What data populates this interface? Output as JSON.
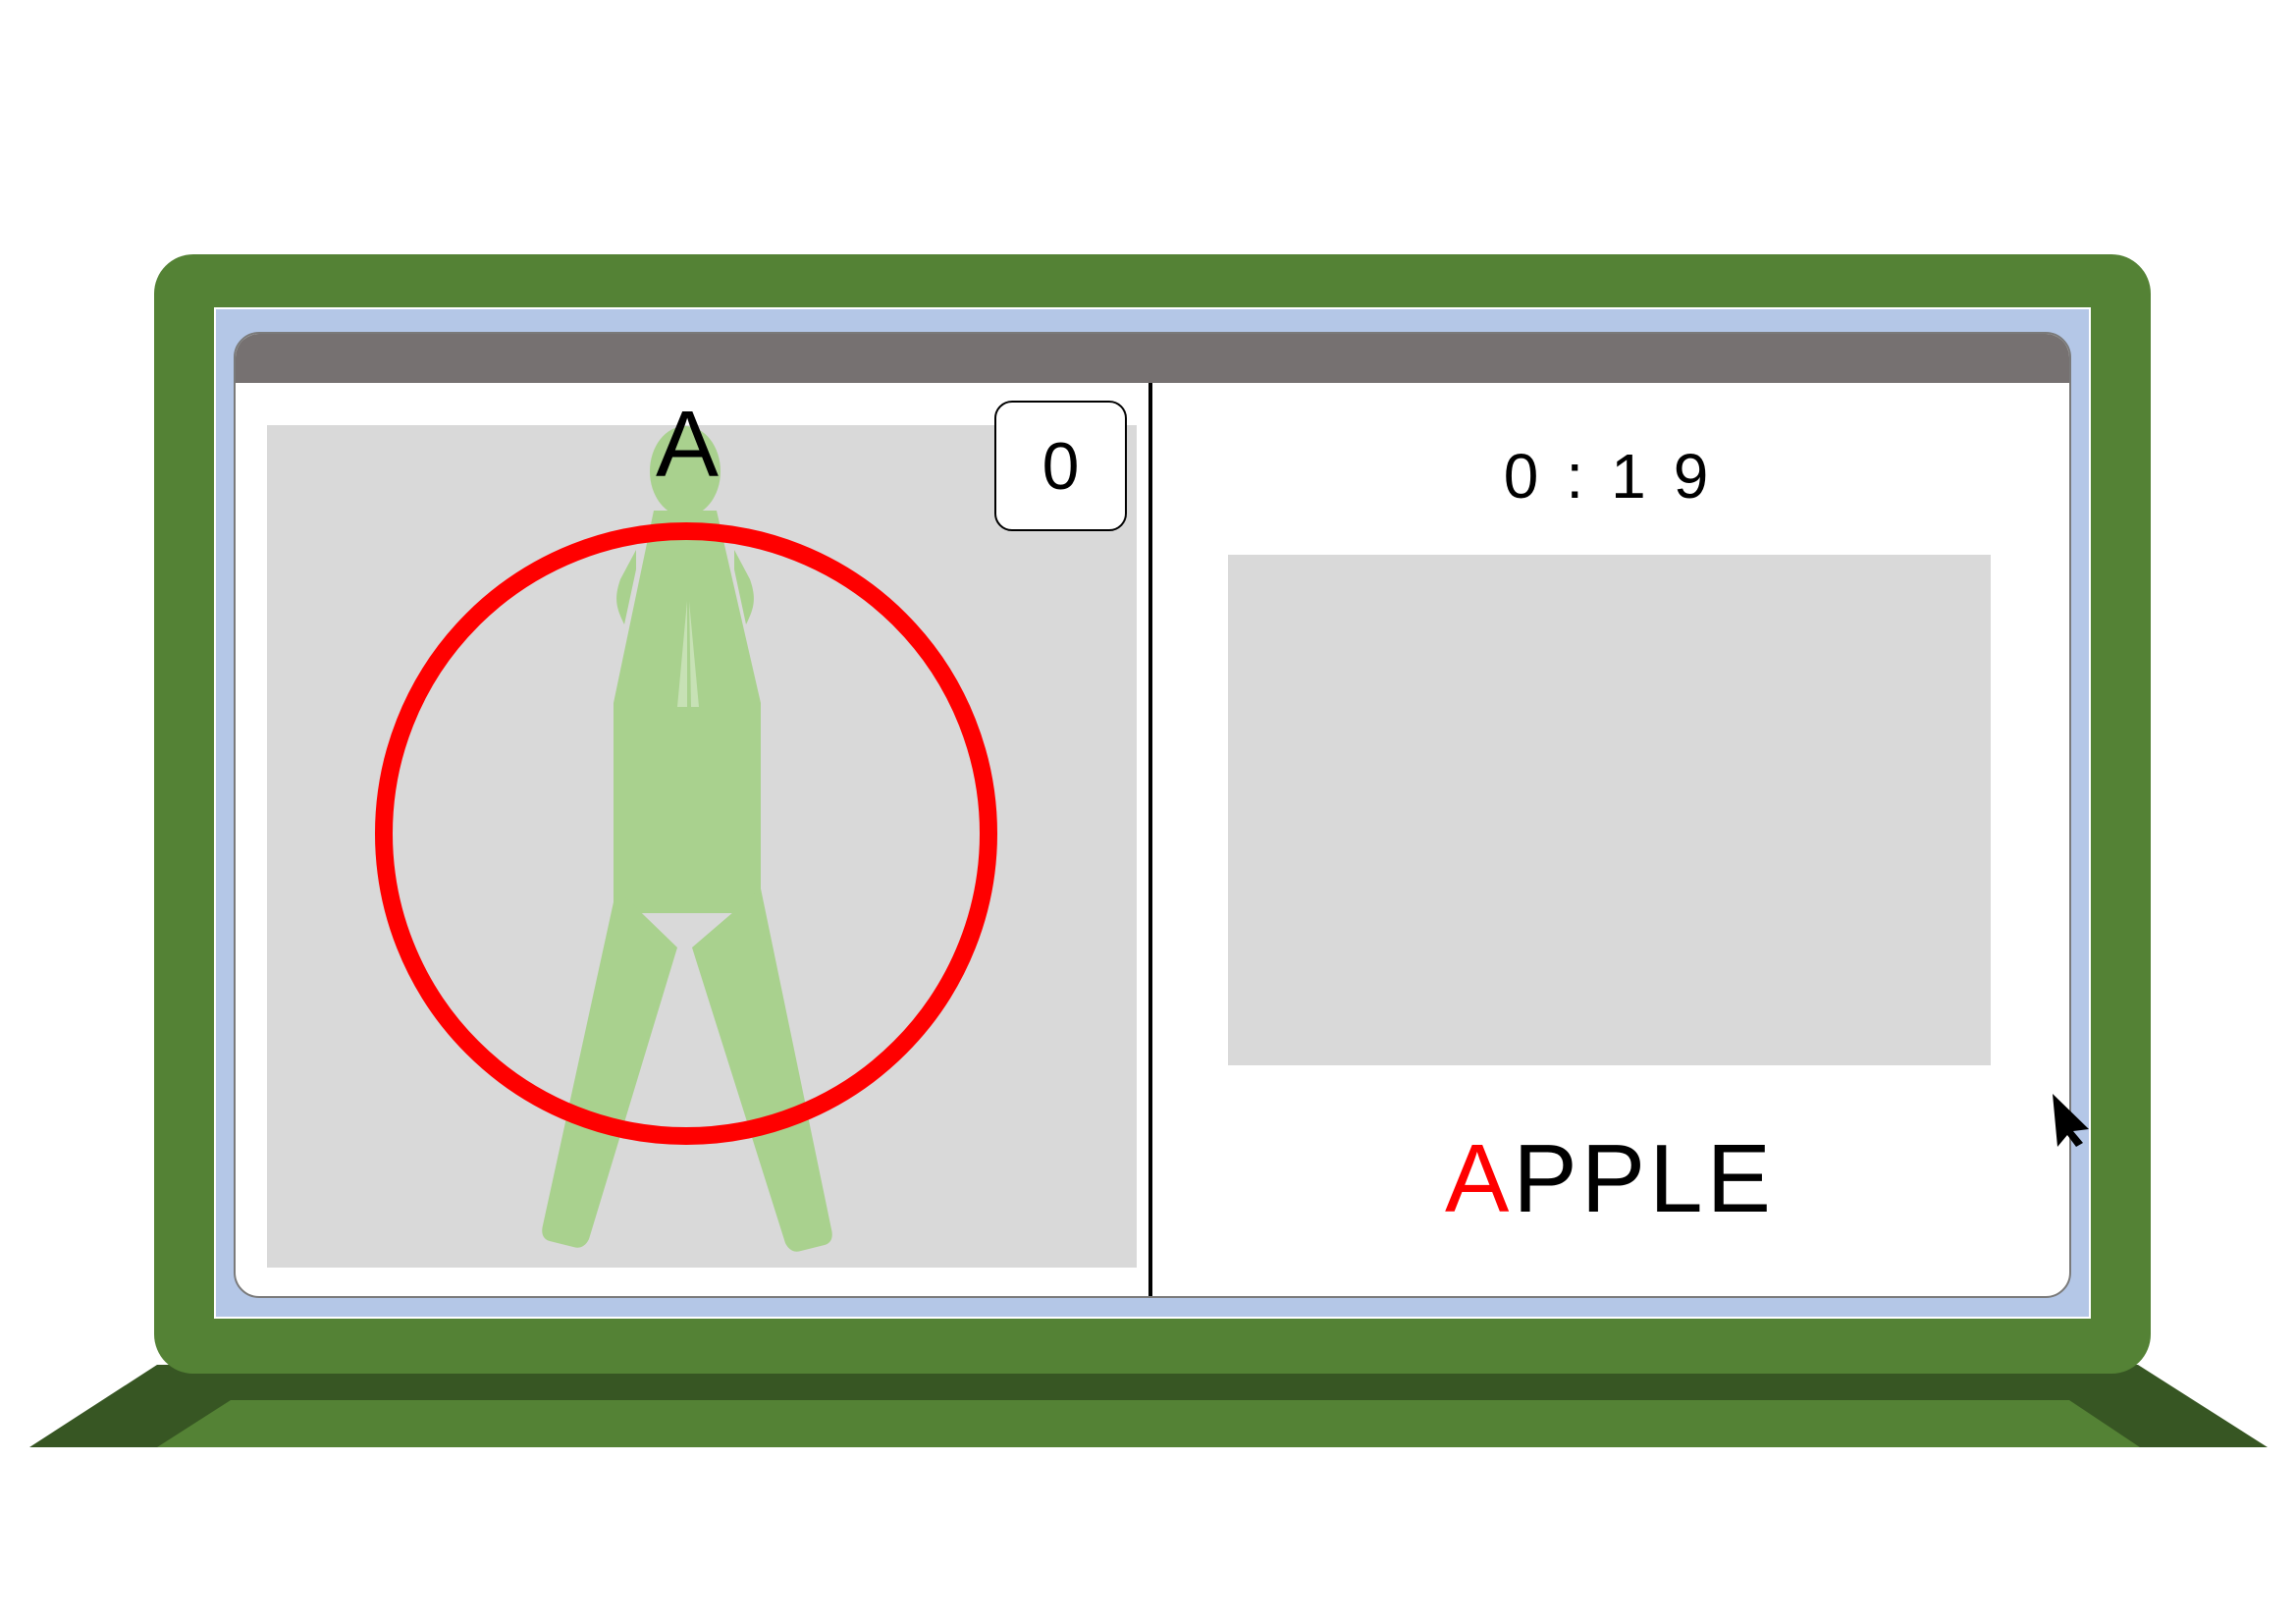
{
  "colors": {
    "laptop_body": "#548235",
    "laptop_base_shadow": "#375623",
    "screen_bezel": "#b4c7e7",
    "window_titlebar": "#767171",
    "panel_placeholder": "#d9d9d9",
    "figure": "#a9d18e",
    "target_ring": "#ff0000",
    "highlight_letter": "#ff0000"
  },
  "left_panel": {
    "pose_letter": "A",
    "score": "0",
    "figure_icon": "standing-person-icon",
    "ring_icon": "target-ring-icon"
  },
  "right_panel": {
    "timer": "0:19",
    "word_highlight": "A",
    "word_rest": "PPLE",
    "image_placeholder": "word-image-placeholder"
  },
  "cursor_icon": "mouse-pointer-icon"
}
